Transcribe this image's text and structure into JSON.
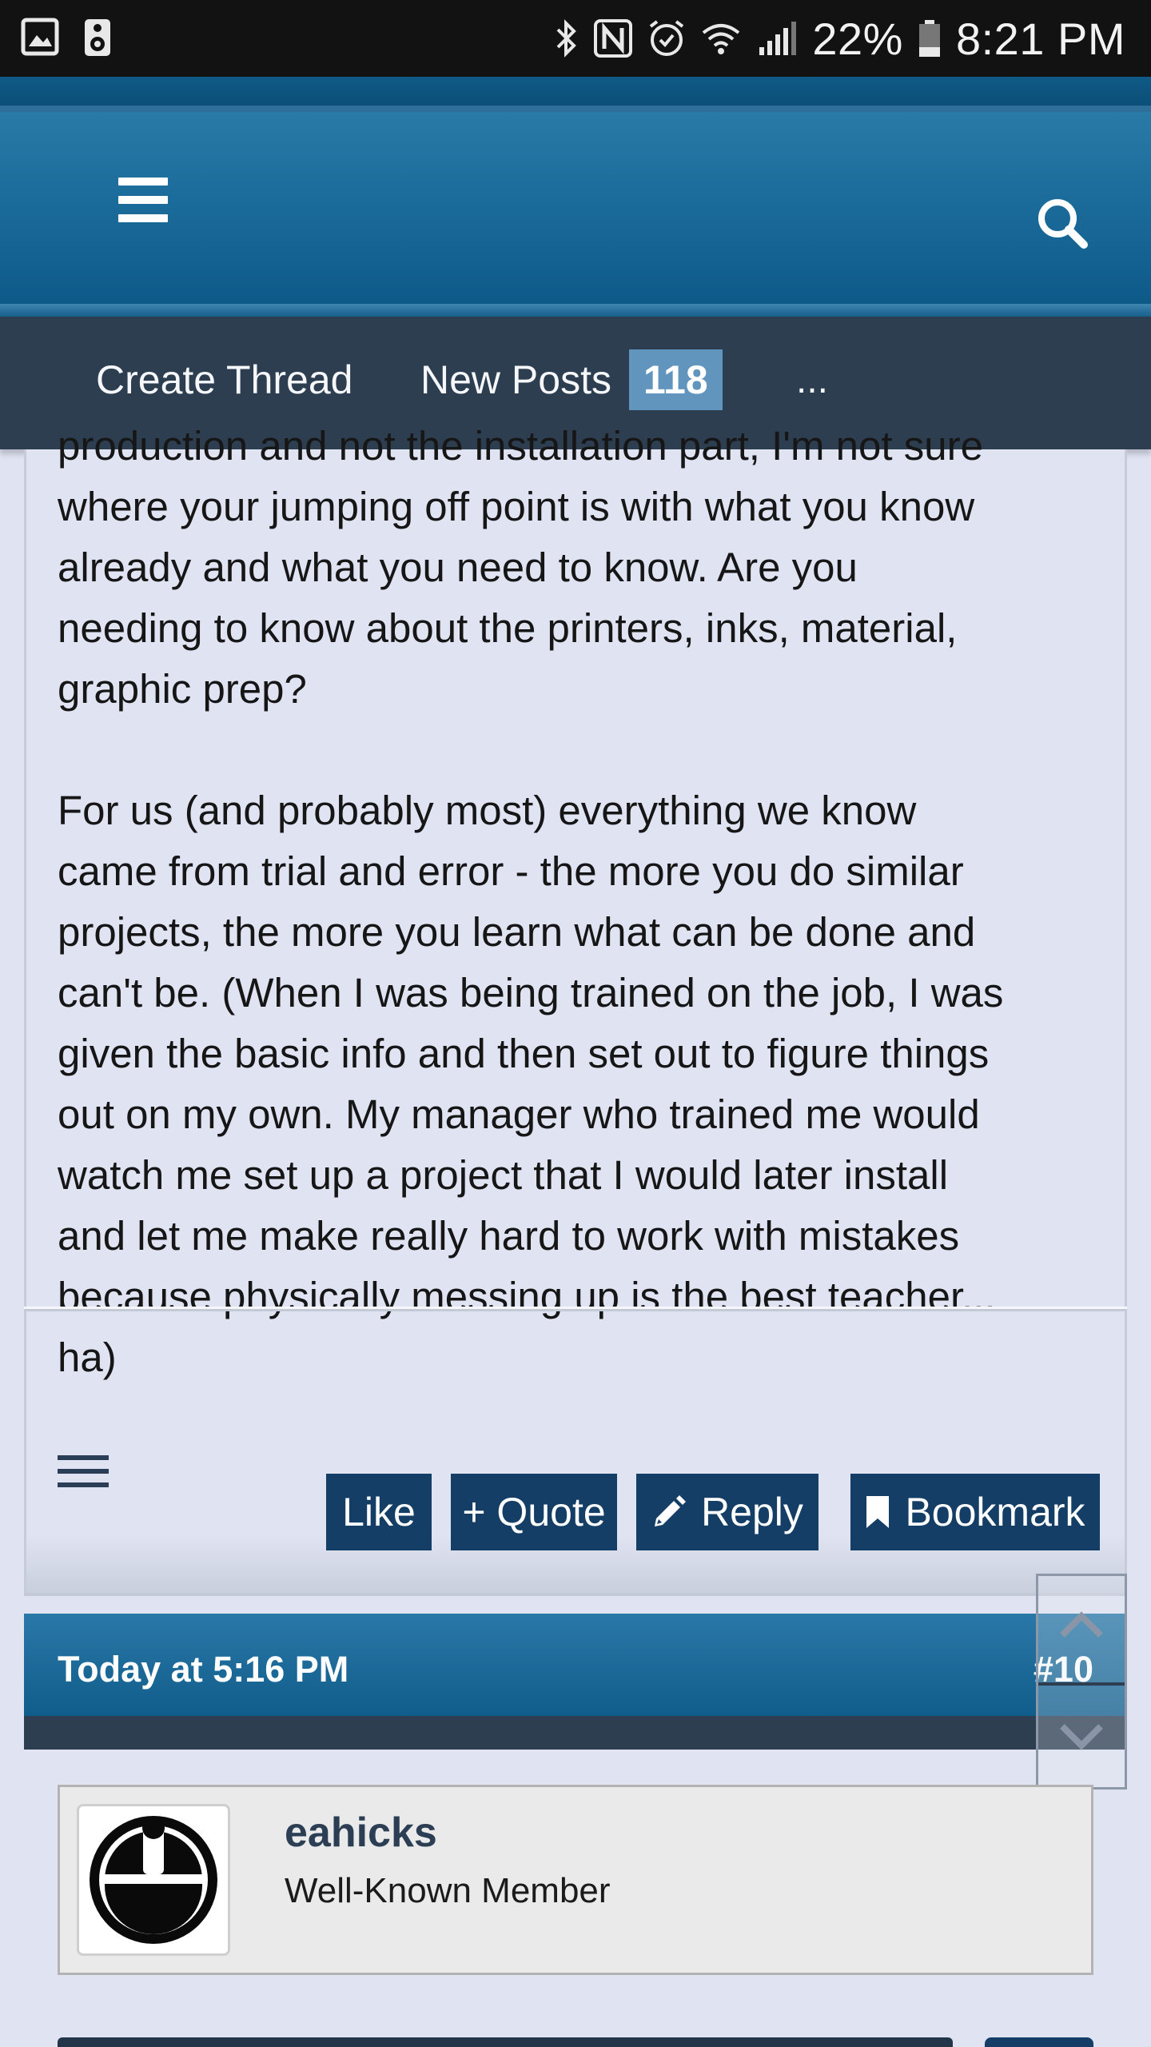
{
  "status_bar": {
    "battery": "22%",
    "time": "8:21 PM",
    "icons": [
      "image-icon",
      "speaker-icon",
      "bluetooth-icon",
      "nfc-icon",
      "alarm-icon",
      "wifi-icon",
      "signal-icon",
      "battery-icon"
    ]
  },
  "header": {
    "menu_icon": "hamburger-menu-icon",
    "search_icon": "search-icon",
    "brand_color": "#1c6c9b"
  },
  "nav": {
    "create_thread": "Create Thread",
    "new_posts": "New Posts",
    "new_posts_count": "118",
    "more": "..."
  },
  "post": {
    "paragraphs": [
      [
        "production and not the installation part, I'm not sure",
        "where your jumping off point is with what you know",
        "already and what you need to know. Are you",
        "needing to know about the printers, inks, material,",
        "graphic prep?"
      ],
      [
        "For us (and probably most) everything we know",
        "came from trial and error - the more you do similar",
        "projects, the more you learn what can be done and",
        "can't be. (When I was being trained on the job, I was",
        "given the basic info and then set out to figure things",
        "out on my own. My manager who trained me would",
        "watch me set up a project that I would later install",
        "and let me make really hard to work with mistakes",
        "because physically messing up is the best teacher...",
        "ha)"
      ]
    ],
    "actions": {
      "like": "Like",
      "quote": "+ Quote",
      "reply": "Reply",
      "bookmark": "Bookmark"
    }
  },
  "next_post": {
    "date": "Today at 5:16 PM",
    "number": "#10",
    "author": {
      "name": "eahicks",
      "title": "Well-Known Member"
    }
  },
  "colors": {
    "nav_bg": "#2d3e50",
    "button_bg": "#143e66",
    "badge_bg": "#6295bd",
    "page_bg": "#dfe3f2"
  }
}
